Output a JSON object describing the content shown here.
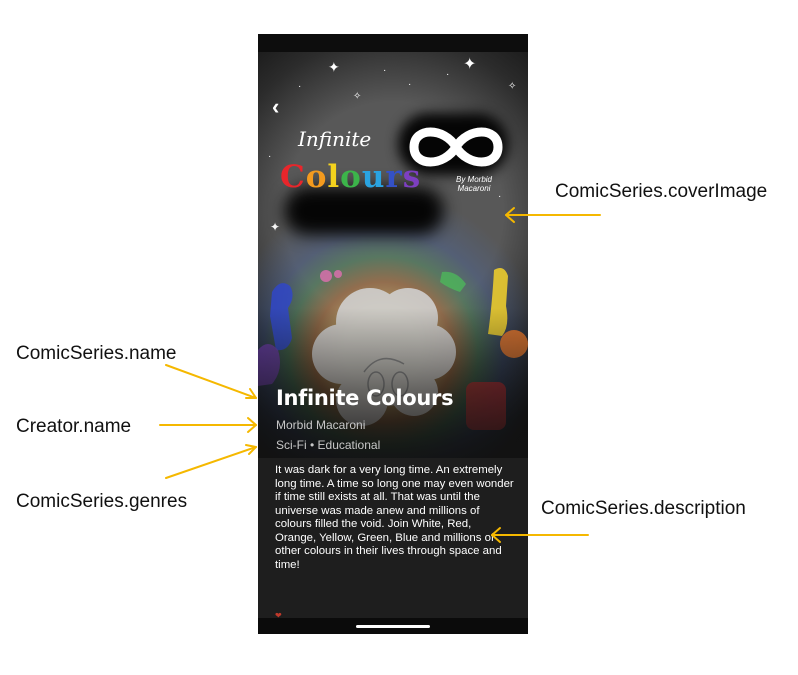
{
  "series": {
    "name": "Infinite Colours",
    "creator": "Morbid Macaroni",
    "genres": "Sci-Fi • Educational",
    "description": "It was dark for a very long time. An extremely long time. A time so long one may even wonder if time still exists at all. That was until the universe was made anew and millions of colours filled the void. Join White, Red, Orange, Yellow, Green, Blue and millions of other colours in their lives through space and time!"
  },
  "cover_art": {
    "logo_line_1": "Infinite",
    "logo_line_2_letters": [
      "C",
      "o",
      "l",
      "o",
      "u",
      "r",
      "s"
    ],
    "logo_line_2_colors": [
      "#e8262b",
      "#f39a1e",
      "#f4d21d",
      "#3cb44a",
      "#2aa3e0",
      "#3451c6",
      "#7d3fc1"
    ],
    "logo_byline": "By Morbid Macaroni"
  },
  "annotations": {
    "cover_image": "ComicSeries.coverImage",
    "series_name": "ComicSeries.name",
    "creator_name": "Creator.name",
    "series_genres": "ComicSeries.genres",
    "series_description": "ComicSeries.description"
  },
  "colors": {
    "arrow": "#f5b800",
    "background": "#121212",
    "text_primary": "#ffffff",
    "text_secondary": "#c8c8c8"
  },
  "icons": {
    "back": "chevron-left-icon"
  }
}
